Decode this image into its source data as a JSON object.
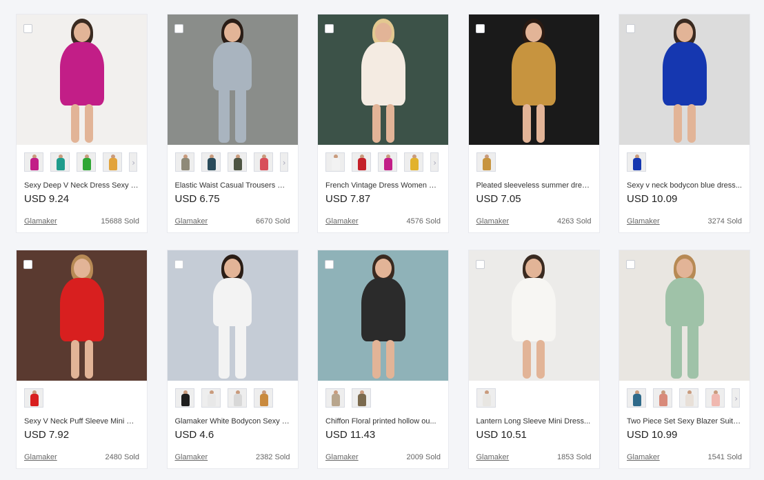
{
  "products": [
    {
      "title": "Sexy Deep V Neck Dress Sexy B...",
      "price": "USD 9.24",
      "store": "Glamaker",
      "sold": "15688 Sold",
      "bg": "#f2f0ee",
      "dress": "#c21e87",
      "hair": "#3a2a20",
      "legs": true,
      "thumbs": [
        "#c21e87",
        "#1f9c8c",
        "#2fa634",
        "#e2a33c"
      ],
      "more": true
    },
    {
      "title": "Elastic Waist Casual Trousers W...",
      "price": "USD 6.75",
      "store": "Glamaker",
      "sold": "6670 Sold",
      "bg": "#8a8d8a",
      "dress": "#a9b4bf",
      "hair": "#2a1d16",
      "legs": false,
      "thumbs": [
        "#8f8a78",
        "#2a4b5a",
        "#4e5543",
        "#d84f5a"
      ],
      "more": true
    },
    {
      "title": "French Vintage Dress Women El...",
      "price": "USD 7.87",
      "store": "Glamaker",
      "sold": "4576 Sold",
      "bg": "#3c5248",
      "dress": "#f4ebe2",
      "hair": "#e3c890",
      "legs": true,
      "thumbs": [
        "#f2f2f2",
        "#c42029",
        "#c21e87",
        "#e2b22c"
      ],
      "more": true
    },
    {
      "title": "Pleated sleeveless summer dres...",
      "price": "USD 7.05",
      "store": "Glamaker",
      "sold": "4263 Sold",
      "bg": "#1a1a1a",
      "dress": "#c7943f",
      "hair": "#2a1a12",
      "legs": true,
      "thumbs": [
        "#c7943f"
      ],
      "more": false
    },
    {
      "title": "Sexy v neck bodycon blue dress...",
      "price": "USD 10.09",
      "store": "Glamaker",
      "sold": "3274 Sold",
      "bg": "#dcdcdc",
      "dress": "#1537b0",
      "hair": "#3a2a20",
      "legs": true,
      "thumbs": [
        "#1537b0"
      ],
      "more": false
    },
    {
      "title": "Sexy V Neck Puff Sleeve Mini Dr...",
      "price": "USD 7.92",
      "store": "Glamaker",
      "sold": "2480 Sold",
      "bg": "#5a3a30",
      "dress": "#d81f1f",
      "hair": "#b78a55",
      "legs": true,
      "thumbs": [
        "#d81f1f"
      ],
      "more": false
    },
    {
      "title": "Glamaker White Bodycon Sexy J...",
      "price": "USD 4.6",
      "store": "Glamaker",
      "sold": "2382 Sold",
      "bg": "#c5ccd6",
      "dress": "#f3f3f3",
      "hair": "#2a1d16",
      "legs": false,
      "thumbs": [
        "#1e1e1e",
        "#e8e8e8",
        "#d8d8d8",
        "#c98a3e"
      ],
      "more": false
    },
    {
      "title": "Chiffon Floral printed hollow ou...",
      "price": "USD 11.43",
      "store": "Glamaker",
      "sold": "2009 Sold",
      "bg": "#8fb2b8",
      "dress": "#2b2b2b",
      "hair": "#3a2a20",
      "legs": true,
      "thumbs": [
        "#b8a58c",
        "#7b6a4e"
      ],
      "more": false
    },
    {
      "title": "Lantern Long Sleeve Mini Dress...",
      "price": "USD 10.51",
      "store": "Glamaker",
      "sold": "1853 Sold",
      "bg": "#ecebe9",
      "dress": "#f7f6f3",
      "hair": "#3a2a20",
      "legs": true,
      "thumbs": [
        "#e8e6e2"
      ],
      "more": false
    },
    {
      "title": "Two Piece Set Sexy Blazer Suits ...",
      "price": "USD 10.99",
      "store": "Glamaker",
      "sold": "1541 Sold",
      "bg": "#e9e6e1",
      "dress": "#9fc2a8",
      "hair": "#b78a55",
      "legs": false,
      "thumbs": [
        "#2f6a8a",
        "#d88a7a",
        "#e8e0d8",
        "#f0b8b0"
      ],
      "more": true
    }
  ]
}
